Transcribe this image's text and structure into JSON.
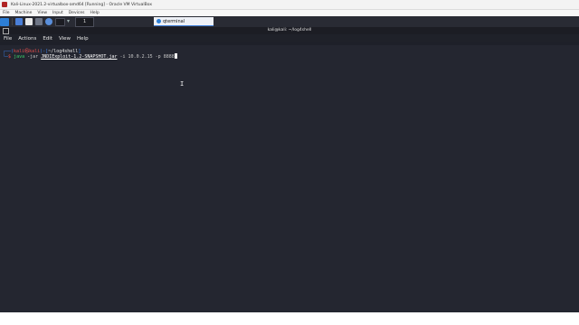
{
  "vbox": {
    "title": "Kali-Linux-2021.2-virtualbox-amd64 [Running] - Oracle VM VirtualBox",
    "menu": [
      "File",
      "Machine",
      "View",
      "Input",
      "Devices",
      "Help"
    ]
  },
  "kali_panel": {
    "workspace_label": "1",
    "active_task": "qterminal"
  },
  "terminal": {
    "window_title": "kali@kali: ~/log4shell",
    "menu": [
      "File",
      "Actions",
      "Edit",
      "View",
      "Help"
    ],
    "prompt_user": "kali",
    "prompt_host": "kali",
    "prompt_dir": "~/log4shell",
    "command": "java",
    "arg1": "-jar",
    "jar": "JNDIExploit-1.2-SNAPSHOT.jar",
    "flag_ip": "-i",
    "ip": "10.0.2.15",
    "flag_port": "-p",
    "port": "8888"
  }
}
